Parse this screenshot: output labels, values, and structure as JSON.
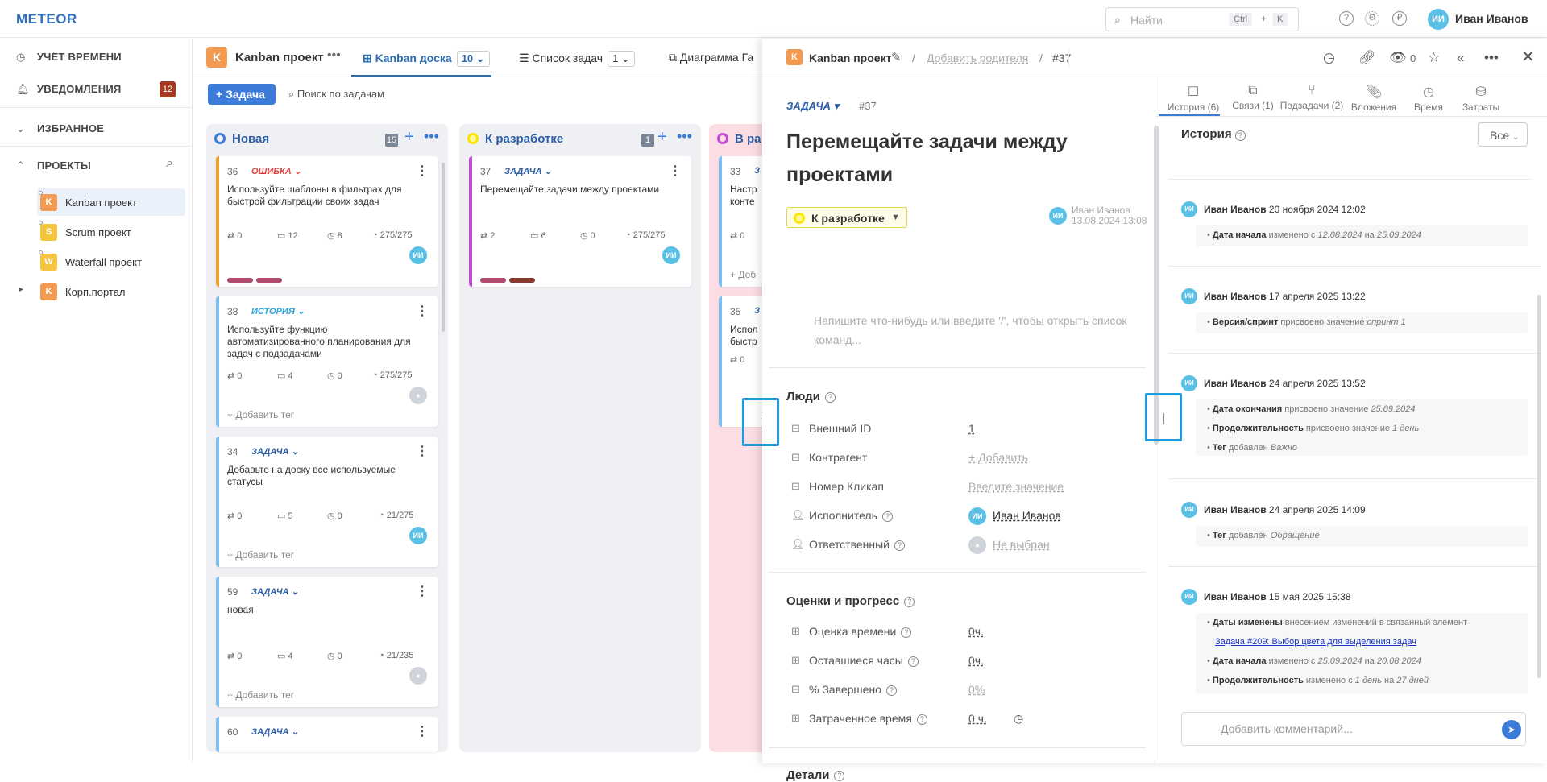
{
  "app": {
    "logo": "METEOR"
  },
  "topbar": {
    "search_placeholder": "Найти",
    "kbd1": "Ctrl",
    "kbd_plus": "+",
    "kbd2": "K",
    "user_initials": "ИИ",
    "user_name": "Иван Иванов"
  },
  "sidebar": {
    "time": "Учёт времени",
    "notifications": "Уведомления",
    "notif_count": "12",
    "favorites": "Избранное",
    "projects": "Проекты",
    "project_items": [
      {
        "icon": "K",
        "label": "Kanban проект",
        "color": "#f39a52"
      },
      {
        "icon": "S",
        "label": "Scrum проект",
        "color": "#f5c542"
      },
      {
        "icon": "W",
        "label": "Waterfall проект",
        "color": "#f5c542"
      },
      {
        "icon": "K",
        "label": "Корп.портал",
        "color": "#f39a52"
      }
    ]
  },
  "board": {
    "project_icon": "K",
    "project": "Kanban проект",
    "tabs": [
      {
        "label": "Kanban доска",
        "count": "10"
      },
      {
        "label": "Список задач",
        "count": "1"
      },
      {
        "label": "Диаграмма Га",
        "count": ""
      }
    ],
    "add_task": "Задача",
    "search": "Поиск по задачам",
    "columns": [
      {
        "name": "Новая",
        "count": "15",
        "color": "#3d7bd9"
      },
      {
        "name": "К разработке",
        "count": "1",
        "color": "#ffe600"
      },
      {
        "name": "В ра",
        "count": "",
        "color": "#c24ad6"
      }
    ],
    "cards_col1": [
      {
        "num": "36",
        "type": "Ошибка",
        "title": "Используйте шаблоны в фильтрах для быстрой фильтрации своих задач",
        "s1": "0",
        "s2": "12",
        "s3": "8",
        "s4": "275/275",
        "av": "ИИ"
      },
      {
        "num": "38",
        "type": "История",
        "title": "Используйте функцию автоматизированного планирования для задач с подзадачами",
        "s1": "0",
        "s2": "4",
        "s3": "0",
        "s4": "275/275",
        "addtag": "+ Добавить тег"
      },
      {
        "num": "34",
        "type": "Задача",
        "title": "Добавьте на доску все используемые статусы",
        "s1": "0",
        "s2": "5",
        "s3": "0",
        "s4": "21/275",
        "av": "ИИ",
        "addtag": "+ Добавить тег"
      },
      {
        "num": "59",
        "type": "Задача",
        "title": "новая",
        "s1": "0",
        "s2": "4",
        "s3": "0",
        "s4": "21/235",
        "addtag": "+ Добавить тег"
      },
      {
        "num": "60",
        "type": "Задача"
      }
    ],
    "card_col2": {
      "num": "37",
      "type": "Задача",
      "title": "Перемещайте задачи между проектами",
      "s1": "2",
      "s2": "6",
      "s3": "0",
      "s4": "275/275",
      "av": "ИИ"
    },
    "cards_col3": [
      {
        "num": "33",
        "type": "З",
        "title": "Настр конте",
        "s1": "0",
        "addtag": "+ Доб"
      },
      {
        "num": "35",
        "type": "З",
        "title": "Испол быстр",
        "s1": "0",
        "addtag": "+ Доб"
      }
    ]
  },
  "panel": {
    "project_icon": "K",
    "project": "Kanban проект",
    "sep": "/",
    "add_parent": "Добавить родителя",
    "id": "#37",
    "watchers": "0",
    "type": "Задача",
    "tid": "#37",
    "title": "Перемещайте задачи между проектами",
    "status": "К разработке",
    "author_initials": "ИИ",
    "author_name": "Иван Иванов",
    "author_date": "13.08.2024 13:08",
    "editor_placeholder": "Напишите что-нибудь или введите '/', чтобы открыть список команд...",
    "people_title": "Люди",
    "people": [
      {
        "label": "Внешний ID",
        "value": "1"
      },
      {
        "label": "Контрагент",
        "value": "+ Добавить"
      },
      {
        "label": "Номер Кликап",
        "value": "Введите значение"
      },
      {
        "label": "Исполнитель",
        "value": "Иван Иванов",
        "av": "ИИ"
      },
      {
        "label": "Ответственный",
        "value": "Не выбран"
      }
    ],
    "estimates_title": "Оценки и прогресс",
    "estimates": [
      {
        "label": "Оценка времени",
        "value": "0ч."
      },
      {
        "label": "Оставшиеся часы",
        "value": "0ч."
      },
      {
        "label": "% Завершено",
        "value": "0%"
      },
      {
        "label": "Затраченное время",
        "value": "0 ч."
      }
    ],
    "details_title": "Детали",
    "right_tabs": [
      "История (6)",
      "Связи (1)",
      "Подзадачи (2)",
      "Вложения",
      "Время",
      "Затраты"
    ],
    "history_title": "История",
    "history_filter": "Все",
    "history": [
      {
        "who": "Иван Иванов",
        "when": "20 ноября 2024 12:02",
        "lines": [
          {
            "b": "Дата начала",
            "t": " изменено с ",
            "e1": "12.08.2024",
            "m": " на ",
            "e2": "25.09.2024"
          }
        ]
      },
      {
        "who": "Иван Иванов",
        "when": "17 апреля 2025 13:22",
        "lines": [
          {
            "b": "Версия/спринт",
            "t": " присвоено значение ",
            "e1": "спринт 1"
          }
        ]
      },
      {
        "who": "Иван Иванов",
        "when": "24 апреля 2025 13:52",
        "lines": [
          {
            "b": "Дата окончания",
            "t": " присвоено значение ",
            "e1": "25.09.2024"
          },
          {
            "b": "Продолжительность",
            "t": " присвоено значение ",
            "e1": "1 день"
          },
          {
            "b": "Тег",
            "t": " добавлен ",
            "e1": "Важно"
          }
        ]
      },
      {
        "who": "Иван Иванов",
        "when": "24 апреля 2025 14:09",
        "lines": [
          {
            "b": "Тег",
            "t": " добавлен ",
            "e1": "Обращение"
          }
        ]
      },
      {
        "who": "Иван Иванов",
        "when": "15 мая 2025 15:38",
        "lines": [
          {
            "b": "Даты изменены",
            "t": " внесением изменений в связанный элемент"
          },
          {
            "link": "Задача #209: Выбор цвета для выделения задач"
          },
          {
            "b": "Дата начала",
            "t": " изменено с ",
            "e1": "25.09.2024",
            "m": " на ",
            "e2": "20.08.2024"
          },
          {
            "b": "Продолжительность",
            "t": " изменено с ",
            "e1": "1 день",
            "m": " на ",
            "e2": "27 дней"
          }
        ]
      }
    ],
    "comment_placeholder": "Добавить комментарий..."
  }
}
